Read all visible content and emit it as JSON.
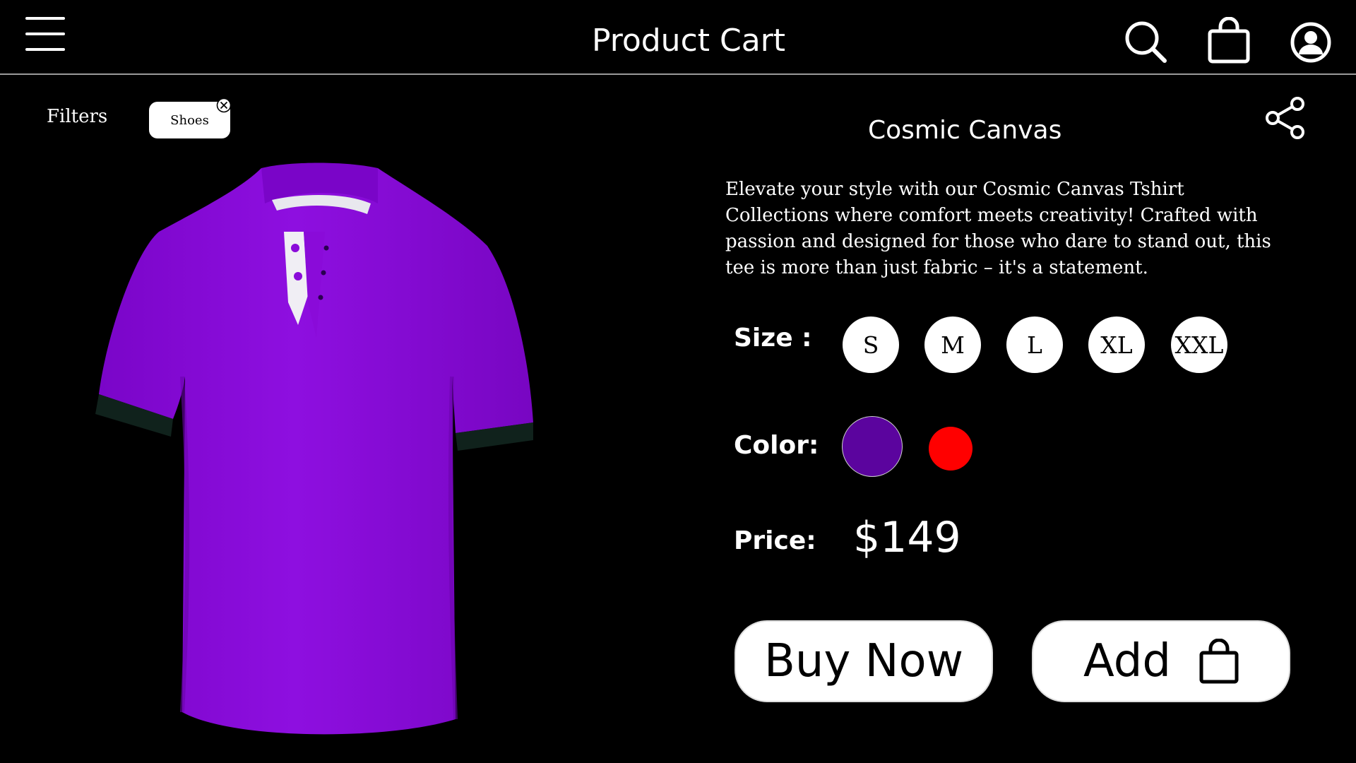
{
  "header": {
    "title": "Product Cart",
    "menu_icon": "hamburger-menu-icon",
    "search_icon": "search-icon",
    "bag_icon": "shopping-bag-icon",
    "account_icon": "user-account-icon"
  },
  "filters": {
    "label": "Filters",
    "chips": [
      {
        "label": "Shoes",
        "close_icon": "close-circle-icon"
      }
    ]
  },
  "product": {
    "image_icon": "purple-polo-tshirt",
    "name": "Cosmic Canvas",
    "share_icon": "share-icon",
    "description": "Elevate your style with our Cosmic Canvas Tshirt Collections where comfort meets creativity! Crafted with passion and designed for those who dare to stand out, this tee is more than just fabric – it's a statement.",
    "size_label": "Size :",
    "sizes": [
      "S",
      "M",
      "L",
      "XL",
      "XXL"
    ],
    "color_label": "Color:",
    "colors": [
      {
        "name": "purple",
        "hex": "#5b049e"
      },
      {
        "name": "red",
        "hex": "#ff0000"
      }
    ],
    "price_label": "Price:",
    "price": "$149"
  },
  "actions": {
    "buy_now": "Buy Now",
    "add": "Add",
    "add_icon": "shopping-bag-icon"
  },
  "theme": {
    "background": "#000000",
    "shirt_color": "#8a0bd9"
  }
}
